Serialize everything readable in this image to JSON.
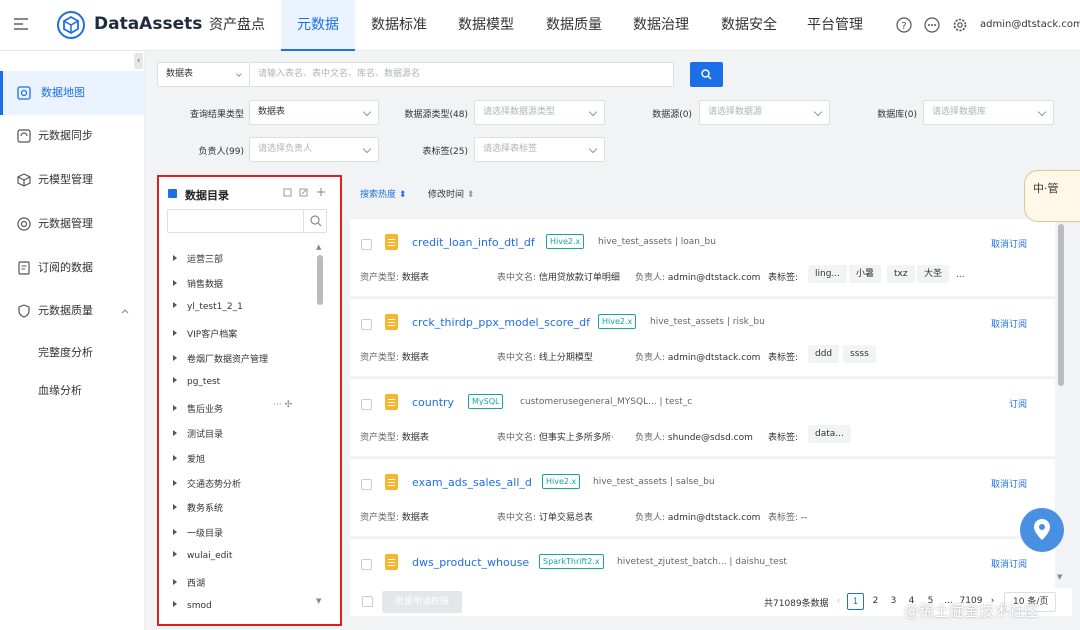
{
  "app": {
    "name": "DataAssets",
    "user": "admin@dtstack.com"
  },
  "nav": [
    "资产盘点",
    "元数据",
    "数据标准",
    "数据模型",
    "数据质量",
    "数据治理",
    "数据安全",
    "平台管理"
  ],
  "nav_active": "元数据",
  "sidebar": {
    "items": [
      "数据地图",
      "元数据同步",
      "元模型管理",
      "元数据管理",
      "订阅的数据",
      "元数据质量"
    ],
    "subitems": [
      "完整度分析",
      "血缘分析"
    ]
  },
  "search": {
    "type": "数据表",
    "placeholder": "请输入表名、表中文名、库名、数据源名"
  },
  "filters": {
    "result_type_label": "查询结果类型",
    "result_type_value": "数据表",
    "source_type_label": "数据源类型(48)",
    "source_type_placeholder": "请选择数据源类型",
    "source_label": "数据源(0)",
    "source_placeholder": "请选择数据源",
    "db_label": "数据库(0)",
    "db_placeholder": "请选择数据库",
    "owner_label": "负责人(99)",
    "owner_placeholder": "请选择负责人",
    "tag_label": "表标签(25)",
    "tag_placeholder": "请选择表标签"
  },
  "catalog": {
    "title": "数据目录",
    "nodes": [
      "运营三部",
      "销售数据",
      "yl_test1_2_1",
      "VIP客户档案",
      "卷烟厂数据资产管理",
      "pg_test",
      "售后业务",
      "测试目录",
      "爱旭",
      "交通态势分析",
      "教务系统",
      "一级目录",
      "wulai_edit",
      "西湖",
      "smod"
    ]
  },
  "sort": {
    "hot": "搜索热度",
    "modified": "修改时间"
  },
  "meta_labels": {
    "asset_type": "资产类型:",
    "cn_name": "表中文名:",
    "owner": "负责人:",
    "tags": "表标签:"
  },
  "results": [
    {
      "name": "credit_loan_info_dtl_df",
      "engine": "Hive2.x",
      "path": "hive_test_assets | loan_bu",
      "action": "取消订阅",
      "asset_type": "数据表",
      "cn_name": "信用贷放款订单明细",
      "owner": "admin@dtstack.com",
      "tags": [
        "ling...",
        "小暑",
        "txz",
        "大圣",
        "..."
      ]
    },
    {
      "name": "crck_thirdp_ppx_model_score_df",
      "engine": "Hive2.x",
      "path": "hive_test_assets | risk_bu",
      "action": "取消订阅",
      "asset_type": "数据表",
      "cn_name": "线上分期模型",
      "owner": "admin@dtstack.com",
      "tags": [
        "ddd",
        "ssss"
      ]
    },
    {
      "name": "country",
      "engine": "MySQL",
      "path": "customerusegeneral_MYSQL... | test_c",
      "action": "订阅",
      "asset_type": "数据表",
      "cn_name": "但事实上多所多所·",
      "owner": "shunde@sdsd.com",
      "tags": [
        "data..."
      ]
    },
    {
      "name": "exam_ads_sales_all_d",
      "engine": "Hive2.x",
      "path": "hive_test_assets | salse_bu",
      "action": "取消订阅",
      "asset_type": "数据表",
      "cn_name": "订单交易总表",
      "owner": "admin@dtstack.com",
      "tags_text": "--"
    },
    {
      "name": "dws_product_whouse",
      "engine": "SparkThrift2.x",
      "path": "hivetest_zjutest_batch... | daishu_test",
      "action": "取消订阅"
    }
  ],
  "footer": {
    "batch": "批量申请权限",
    "total": "共71089条数据",
    "pages": [
      "1",
      "2",
      "3",
      "4",
      "5",
      "...",
      "7109"
    ],
    "page_size": "10 条/页"
  },
  "float_badge": "中·管",
  "watermark": "@稀土掘金技术社区",
  "colors": {
    "accent": "#1d6fe8",
    "highlight_border": "#e02020",
    "tag": "#1aa3a3",
    "file_icon": "#f5b731"
  }
}
